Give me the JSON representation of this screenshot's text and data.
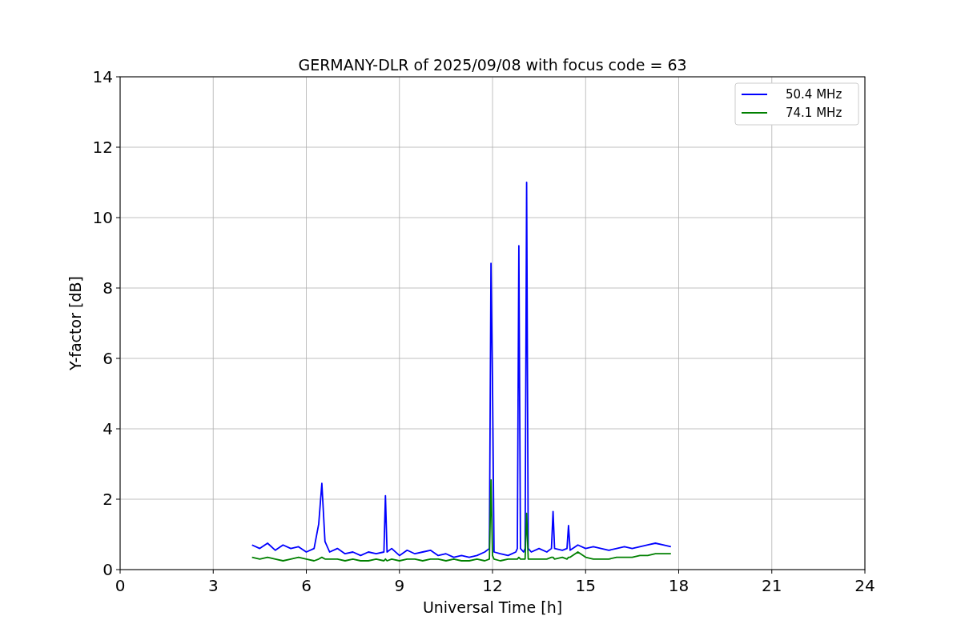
{
  "chart_data": {
    "type": "line",
    "title": "GERMANY-DLR of 2025/09/08 with focus code = 63",
    "xlabel": "Universal Time [h]",
    "ylabel": "Y-factor [dB]",
    "x": [
      4.25,
      4.5,
      4.75,
      5,
      5.25,
      5.5,
      5.75,
      6,
      6.25,
      6.4,
      6.5,
      6.6,
      6.75,
      7,
      7.25,
      7.5,
      7.75,
      8,
      8.25,
      8.5,
      8.55,
      8.6,
      8.75,
      9,
      9.25,
      9.5,
      9.75,
      10,
      10.25,
      10.5,
      10.75,
      11,
      11.25,
      11.5,
      11.75,
      11.9,
      11.95,
      12.0,
      12.05,
      12.25,
      12.5,
      12.75,
      12.8,
      12.85,
      12.9,
      13.0,
      13.05,
      13.1,
      13.15,
      13.25,
      13.5,
      13.75,
      13.9,
      13.95,
      14.0,
      14.25,
      14.4,
      14.45,
      14.5,
      14.75,
      15,
      15.25,
      15.5,
      15.75,
      16,
      16.25,
      16.5,
      16.75,
      17,
      17.25,
      17.5,
      17.75
    ],
    "series": [
      {
        "name": "50.4 MHz",
        "color": "#0000ff",
        "values": [
          0.7,
          0.6,
          0.75,
          0.55,
          0.7,
          0.6,
          0.65,
          0.5,
          0.6,
          1.3,
          2.45,
          0.8,
          0.5,
          0.6,
          0.45,
          0.5,
          0.4,
          0.5,
          0.45,
          0.5,
          2.1,
          0.5,
          0.6,
          0.4,
          0.55,
          0.45,
          0.5,
          0.55,
          0.4,
          0.45,
          0.35,
          0.4,
          0.35,
          0.4,
          0.5,
          0.6,
          8.7,
          5.3,
          0.5,
          0.45,
          0.4,
          0.5,
          0.6,
          9.2,
          0.6,
          0.5,
          0.6,
          11.0,
          0.6,
          0.5,
          0.6,
          0.5,
          0.6,
          1.65,
          0.6,
          0.55,
          0.6,
          1.25,
          0.55,
          0.7,
          0.6,
          0.65,
          0.6,
          0.55,
          0.6,
          0.65,
          0.6,
          0.65,
          0.7,
          0.75,
          0.7,
          0.65
        ]
      },
      {
        "name": "74.1 MHz",
        "color": "#008000",
        "values": [
          0.35,
          0.3,
          0.35,
          0.3,
          0.25,
          0.3,
          0.35,
          0.3,
          0.25,
          0.3,
          0.35,
          0.3,
          0.3,
          0.3,
          0.25,
          0.3,
          0.25,
          0.25,
          0.3,
          0.25,
          0.3,
          0.25,
          0.3,
          0.25,
          0.3,
          0.3,
          0.25,
          0.3,
          0.3,
          0.25,
          0.3,
          0.25,
          0.25,
          0.3,
          0.25,
          0.3,
          2.55,
          0.4,
          0.3,
          0.25,
          0.3,
          0.3,
          0.3,
          0.35,
          0.3,
          0.3,
          0.3,
          1.6,
          0.3,
          0.3,
          0.3,
          0.3,
          0.35,
          0.35,
          0.3,
          0.35,
          0.3,
          0.35,
          0.35,
          0.5,
          0.35,
          0.3,
          0.3,
          0.3,
          0.35,
          0.35,
          0.35,
          0.4,
          0.4,
          0.45,
          0.45,
          0.45
        ]
      }
    ],
    "grid": true,
    "legend": true,
    "xlim": [
      0,
      24
    ],
    "ylim": [
      0,
      14
    ],
    "xticks": [
      0,
      3,
      6,
      9,
      12,
      15,
      18,
      21,
      24
    ],
    "yticks": [
      0,
      2,
      4,
      6,
      8,
      10,
      12,
      14
    ]
  }
}
